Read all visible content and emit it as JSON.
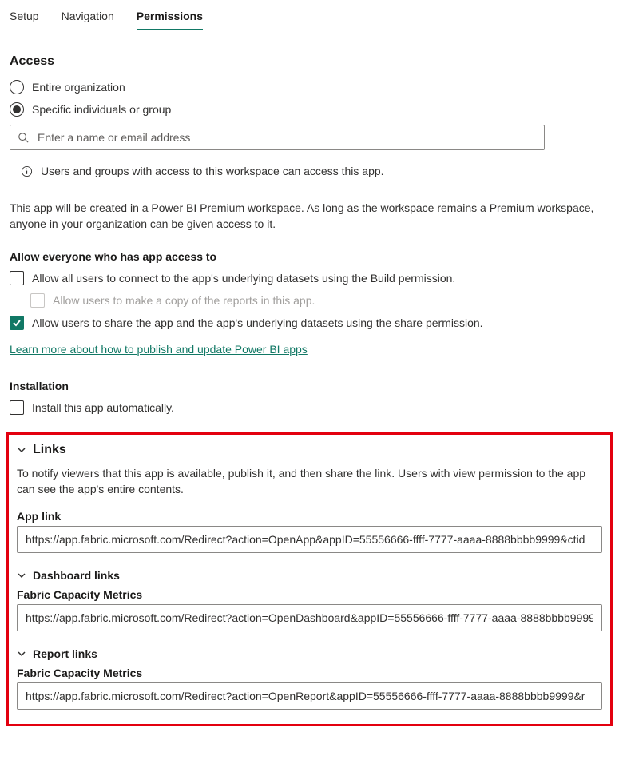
{
  "tabs": {
    "setup": "Setup",
    "navigation": "Navigation",
    "permissions": "Permissions"
  },
  "access": {
    "heading": "Access",
    "entire_org": "Entire organization",
    "specific": "Specific individuals or group",
    "search_placeholder": "Enter a name or email address",
    "info": "Users and groups with access to this workspace can access this app.",
    "premium_note": "This app will be created in a Power BI Premium workspace. As long as the workspace remains a Premium workspace, anyone in your organization can be given access to it."
  },
  "allow": {
    "heading": "Allow everyone who has app access to",
    "build": "Allow all users to connect to the app's underlying datasets using the Build permission.",
    "copy": "Allow users to make a copy of the reports in this app.",
    "share": "Allow users to share the app and the app's underlying datasets using the share permission.",
    "learn_link": "Learn more about how to publish and update Power BI apps"
  },
  "install": {
    "heading": "Installation",
    "auto": "Install this app automatically."
  },
  "links": {
    "heading": "Links",
    "desc": "To notify viewers that this app is available, publish it, and then share the link. Users with view permission to the app can see the app's entire contents.",
    "app_link_label": "App link",
    "app_link_value": "https://app.fabric.microsoft.com/Redirect?action=OpenApp&appID=55556666-ffff-7777-aaaa-8888bbbb9999&ctid",
    "dashboard_heading": "Dashboard links",
    "dashboard_label": "Fabric Capacity Metrics",
    "dashboard_value": "https://app.fabric.microsoft.com/Redirect?action=OpenDashboard&appID=55556666-ffff-7777-aaaa-8888bbbb9999",
    "report_heading": "Report links",
    "report_label": "Fabric Capacity Metrics",
    "report_value": "https://app.fabric.microsoft.com/Redirect?action=OpenReport&appID=55556666-ffff-7777-aaaa-8888bbbb9999&r"
  }
}
